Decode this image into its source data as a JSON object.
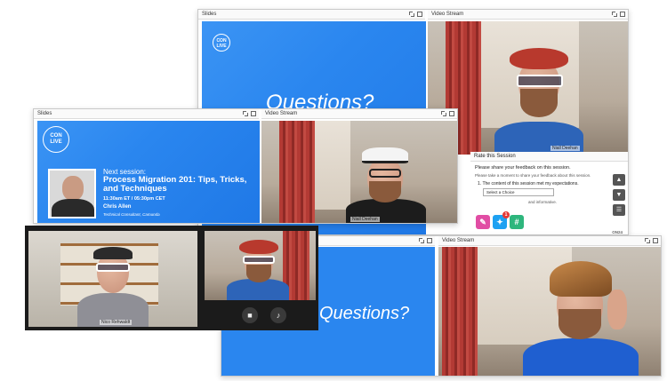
{
  "colors": {
    "brand_blue": "#2a86ef",
    "zoom_dark": "#1b1b1b",
    "twitter": "#1da1f2",
    "slack_green": "#2eb67d",
    "pink": "#e14da4"
  },
  "window1": {
    "slides_label": "Slides",
    "video_label": "Video Stream",
    "slide_text": "Questions?",
    "logo_lines": [
      "CAMUNDA",
      "CON",
      "LIVE"
    ],
    "presenter_name": "Niall Deehan",
    "rate_panel": {
      "title": "Rate this Session",
      "prompt": "Please share your feedback on this session.",
      "subprompt": "Please take a moment to share your feedback about this session.",
      "question_1": "1.  The content of this session met my expectations.",
      "select_placeholder": "Select a Choice",
      "trailing_text": "and informative.",
      "watermark": "ON24"
    },
    "side_icons": [
      "thumbs-up-icon",
      "thumbs-down-icon",
      "comment-icon"
    ]
  },
  "window2": {
    "slides_label": "Slides",
    "video_label": "Video Stream",
    "logo_lines": [
      "CAMUNDA",
      "CON",
      "LIVE"
    ],
    "next_label": "Next session:",
    "session_title": "Process Migration 201: Tips, Tricks, and Techniques",
    "session_time": "11:30am ET / 05:30pm CET",
    "speaker_name": "Chris Allen",
    "speaker_role": "Technical Consultant, Camunda",
    "presenter_name": "Niall Deehan"
  },
  "window3": {
    "slide_text": "Questions?",
    "video_label": "Video Stream"
  },
  "zoom_call": {
    "left_participant": "Nico Rehwaldt",
    "controls": [
      "camera-icon",
      "microphone-icon"
    ]
  },
  "apps": [
    {
      "name": "paint-icon",
      "glyph": "✎",
      "color": "#e14da4"
    },
    {
      "name": "twitter-icon",
      "glyph": "✦",
      "color": "#1da1f2",
      "badge": "1"
    },
    {
      "name": "slack-icon",
      "glyph": "#",
      "color": "#2eb67d"
    }
  ]
}
